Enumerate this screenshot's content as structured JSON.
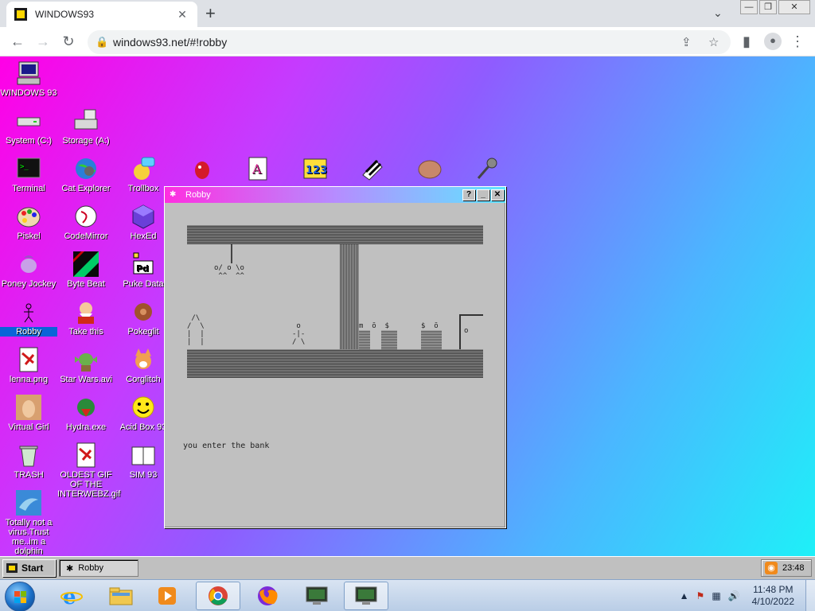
{
  "browser": {
    "tab_title": "WINDOWS93",
    "url": "windows93.net/#!robby"
  },
  "desktop": {
    "icons": [
      {
        "id": "windows93",
        "label": "WINDOWS 93"
      },
      {
        "id": "system-c",
        "label": "System (C:)"
      },
      {
        "id": "storage-a",
        "label": "Storage (A:)"
      },
      {
        "id": "terminal",
        "label": "Terminal"
      },
      {
        "id": "cat-explorer",
        "label": "Cat Explorer"
      },
      {
        "id": "trollbox",
        "label": "Trollbox"
      },
      {
        "id": "piskel",
        "label": "Piskel"
      },
      {
        "id": "codemirror",
        "label": "CodeMirror"
      },
      {
        "id": "hexed",
        "label": "HexEd"
      },
      {
        "id": "poney-jockey",
        "label": "Poney Jockey"
      },
      {
        "id": "byte-beat",
        "label": "Byte Beat"
      },
      {
        "id": "puke-data",
        "label": "Puke Data"
      },
      {
        "id": "robby",
        "label": "Robby"
      },
      {
        "id": "take-this",
        "label": "Take this"
      },
      {
        "id": "pokeglit",
        "label": "Pokeglit"
      },
      {
        "id": "lenna",
        "label": "lenna.png"
      },
      {
        "id": "star-wars",
        "label": "Star Wars.avi"
      },
      {
        "id": "corglitch",
        "label": "Corglitch"
      },
      {
        "id": "virtual-girl",
        "label": "Virtual Girl"
      },
      {
        "id": "hydra",
        "label": "Hydra.exe"
      },
      {
        "id": "acid-box",
        "label": "Acid Box 93"
      },
      {
        "id": "trash",
        "label": "TRASH"
      },
      {
        "id": "oldest-gif",
        "label": "OLDEST GIF OF THE INTERWEBZ.gif"
      },
      {
        "id": "sim93",
        "label": "SIM 93"
      },
      {
        "id": "dolphin",
        "label": "Totally not a virus.Trust me..im a dolphin"
      }
    ]
  },
  "robby_window": {
    "title": "Robby",
    "help": "?",
    "minimize": "_",
    "close": "✕",
    "game_message": "you enter the bank",
    "ascii": {
      "hanging_figure": "o/ o \\o\n ^^  ^^",
      "tower": " /\\\n/  \\\n|  |\n|  |",
      "player": " o\n-|-\n/ \\",
      "teller1": "m  ō  $",
      "teller2": "$  ō",
      "door": "o"
    }
  },
  "win93_taskbar": {
    "start_label": "Start",
    "task_label": "Robby",
    "time": "23:48"
  },
  "win7_taskbar": {
    "time": "11:48 PM",
    "date": "4/10/2022"
  }
}
